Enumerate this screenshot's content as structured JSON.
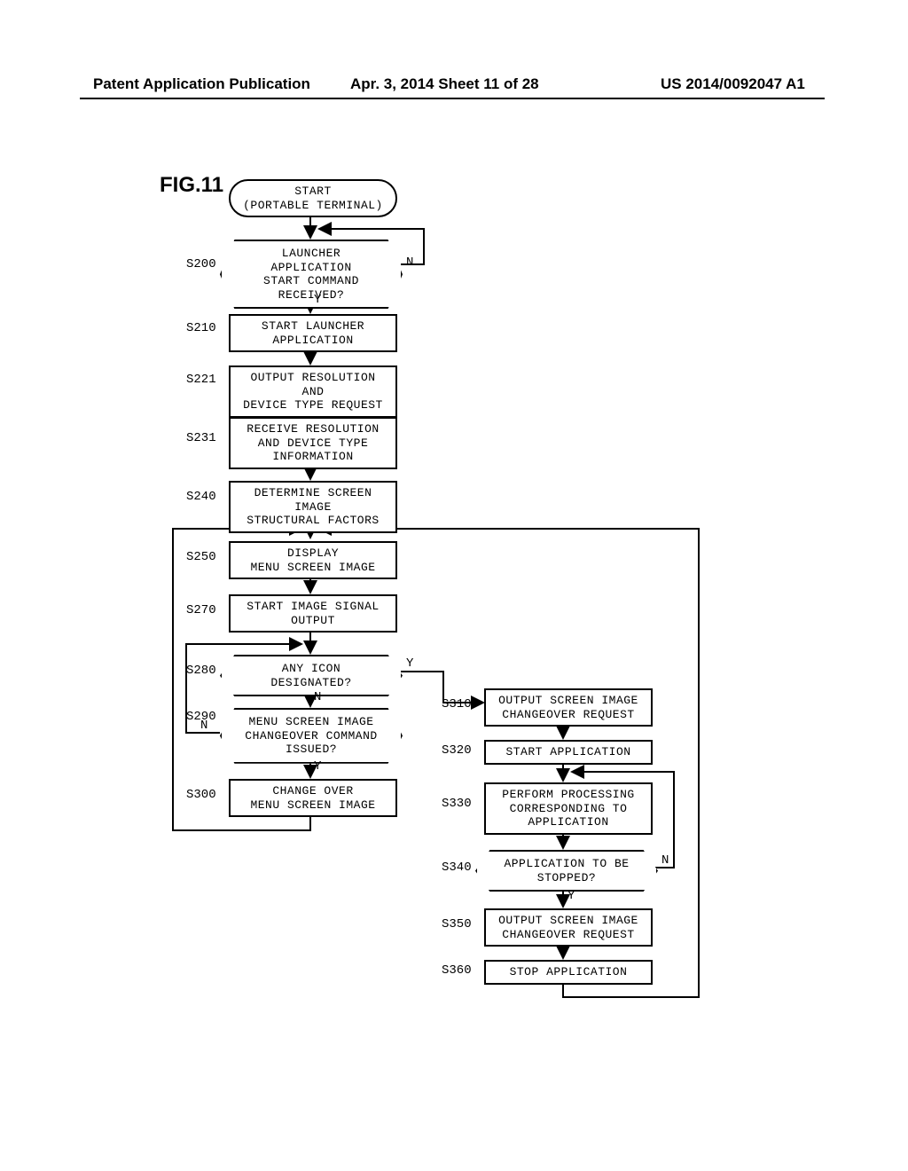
{
  "header": {
    "left": "Patent Application Publication",
    "center": "Apr. 3, 2014   Sheet 11 of 28",
    "right": "US 2014/0092047 A1"
  },
  "figure_label": "FIG.11",
  "nodes": {
    "start": "START\n(PORTABLE TERMINAL)",
    "s200": "LAUNCHER APPLICATION\nSTART COMMAND\nRECEIVED?",
    "s210": "START LAUNCHER\nAPPLICATION",
    "s221": "OUTPUT RESOLUTION AND\nDEVICE TYPE REQUEST",
    "s231": "RECEIVE RESOLUTION\nAND DEVICE TYPE\nINFORMATION",
    "s240": "DETERMINE SCREEN IMAGE\nSTRUCTURAL FACTORS",
    "s250": "DISPLAY\nMENU SCREEN IMAGE",
    "s270": "START IMAGE SIGNAL\nOUTPUT",
    "s280": "ANY ICON\nDESIGNATED?",
    "s290": "MENU SCREEN IMAGE\nCHANGEOVER COMMAND\nISSUED?",
    "s300": "CHANGE OVER\nMENU SCREEN IMAGE",
    "s310": "OUTPUT SCREEN IMAGE\nCHANGEOVER REQUEST",
    "s320": "START APPLICATION",
    "s330": "PERFORM PROCESSING\nCORRESPONDING TO\nAPPLICATION",
    "s340": "APPLICATION TO BE\nSTOPPED?",
    "s350": "OUTPUT SCREEN IMAGE\nCHANGEOVER REQUEST",
    "s360": "STOP APPLICATION"
  },
  "labels": {
    "s200": "S200",
    "s210": "S210",
    "s221": "S221",
    "s231": "S231",
    "s240": "S240",
    "s250": "S250",
    "s270": "S270",
    "s280": "S280",
    "s290": "S290",
    "s300": "S300",
    "s310": "S310",
    "s320": "S320",
    "s330": "S330",
    "s340": "S340",
    "s350": "S350",
    "s360": "S360"
  },
  "yn": {
    "Y": "Y",
    "N": "N"
  },
  "chart_data": {
    "type": "flowchart",
    "title": "FIG.11 Portable Terminal Flow",
    "nodes": [
      {
        "id": "start",
        "type": "terminator",
        "text": "START (PORTABLE TERMINAL)"
      },
      {
        "id": "S200",
        "type": "decision",
        "text": "LAUNCHER APPLICATION START COMMAND RECEIVED?"
      },
      {
        "id": "S210",
        "type": "process",
        "text": "START LAUNCHER APPLICATION"
      },
      {
        "id": "S221",
        "type": "process",
        "text": "OUTPUT RESOLUTION AND DEVICE TYPE REQUEST"
      },
      {
        "id": "S231",
        "type": "process",
        "text": "RECEIVE RESOLUTION AND DEVICE TYPE INFORMATION"
      },
      {
        "id": "S240",
        "type": "process",
        "text": "DETERMINE SCREEN IMAGE STRUCTURAL FACTORS"
      },
      {
        "id": "S250",
        "type": "process",
        "text": "DISPLAY MENU SCREEN IMAGE"
      },
      {
        "id": "S270",
        "type": "process",
        "text": "START IMAGE SIGNAL OUTPUT"
      },
      {
        "id": "S280",
        "type": "decision",
        "text": "ANY ICON DESIGNATED?"
      },
      {
        "id": "S290",
        "type": "decision",
        "text": "MENU SCREEN IMAGE CHANGEOVER COMMAND ISSUED?"
      },
      {
        "id": "S300",
        "type": "process",
        "text": "CHANGE OVER MENU SCREEN IMAGE"
      },
      {
        "id": "S310",
        "type": "process",
        "text": "OUTPUT SCREEN IMAGE CHANGEOVER REQUEST"
      },
      {
        "id": "S320",
        "type": "process",
        "text": "START APPLICATION"
      },
      {
        "id": "S330",
        "type": "process",
        "text": "PERFORM PROCESSING CORRESPONDING TO APPLICATION"
      },
      {
        "id": "S340",
        "type": "decision",
        "text": "APPLICATION TO BE STOPPED?"
      },
      {
        "id": "S350",
        "type": "process",
        "text": "OUTPUT SCREEN IMAGE CHANGEOVER REQUEST"
      },
      {
        "id": "S360",
        "type": "process",
        "text": "STOP APPLICATION"
      }
    ],
    "edges": [
      {
        "from": "start",
        "to": "S200"
      },
      {
        "from": "S200",
        "to": "S210",
        "label": "Y"
      },
      {
        "from": "S200",
        "to": "S200",
        "label": "N",
        "note": "loop back above"
      },
      {
        "from": "S210",
        "to": "S221"
      },
      {
        "from": "S221",
        "to": "S231"
      },
      {
        "from": "S231",
        "to": "S240"
      },
      {
        "from": "S240",
        "to": "S250"
      },
      {
        "from": "S250",
        "to": "S270"
      },
      {
        "from": "S270",
        "to": "S280"
      },
      {
        "from": "S280",
        "to": "S310",
        "label": "Y"
      },
      {
        "from": "S280",
        "to": "S290",
        "label": "N"
      },
      {
        "from": "S290",
        "to": "S300",
        "label": "Y"
      },
      {
        "from": "S290",
        "to": "S280",
        "label": "N",
        "note": "loop back"
      },
      {
        "from": "S300",
        "to": "S280",
        "note": "loop back to designation check via S250 merge"
      },
      {
        "from": "S310",
        "to": "S320"
      },
      {
        "from": "S320",
        "to": "S330"
      },
      {
        "from": "S330",
        "to": "S340"
      },
      {
        "from": "S340",
        "to": "S350",
        "label": "Y"
      },
      {
        "from": "S340",
        "to": "S330",
        "label": "N",
        "note": "loop back"
      },
      {
        "from": "S350",
        "to": "S360"
      },
      {
        "from": "S360",
        "to": "S250",
        "note": "return to menu display (far right loop)"
      }
    ]
  }
}
